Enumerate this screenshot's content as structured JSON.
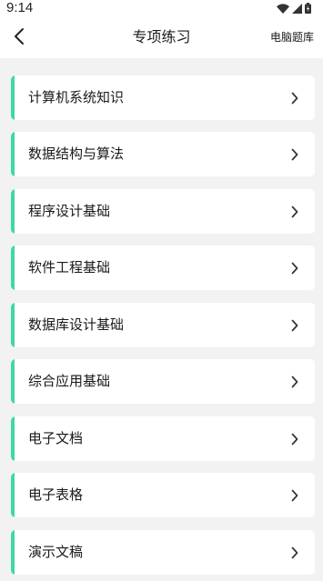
{
  "status_bar": {
    "time": "9:14",
    "icons": [
      "wifi-icon",
      "cellular-signal-icon",
      "battery-icon"
    ]
  },
  "nav": {
    "back_icon": "chevron-left-icon",
    "title": "专项练习",
    "action_label": "电脑题库"
  },
  "colors": {
    "accent": "#3fd7a6",
    "background": "#f2f2f2",
    "card": "#ffffff",
    "text": "#1a1a1a"
  },
  "items": [
    {
      "label": "计算机系统知识",
      "icon": "chevron-right-icon"
    },
    {
      "label": "数据结构与算法",
      "icon": "chevron-right-icon"
    },
    {
      "label": "程序设计基础",
      "icon": "chevron-right-icon"
    },
    {
      "label": "软件工程基础",
      "icon": "chevron-right-icon"
    },
    {
      "label": "数据库设计基础",
      "icon": "chevron-right-icon"
    },
    {
      "label": "综合应用基础",
      "icon": "chevron-right-icon"
    },
    {
      "label": "电子文档",
      "icon": "chevron-right-icon"
    },
    {
      "label": "电子表格",
      "icon": "chevron-right-icon"
    },
    {
      "label": "演示文稿",
      "icon": "chevron-right-icon"
    }
  ]
}
